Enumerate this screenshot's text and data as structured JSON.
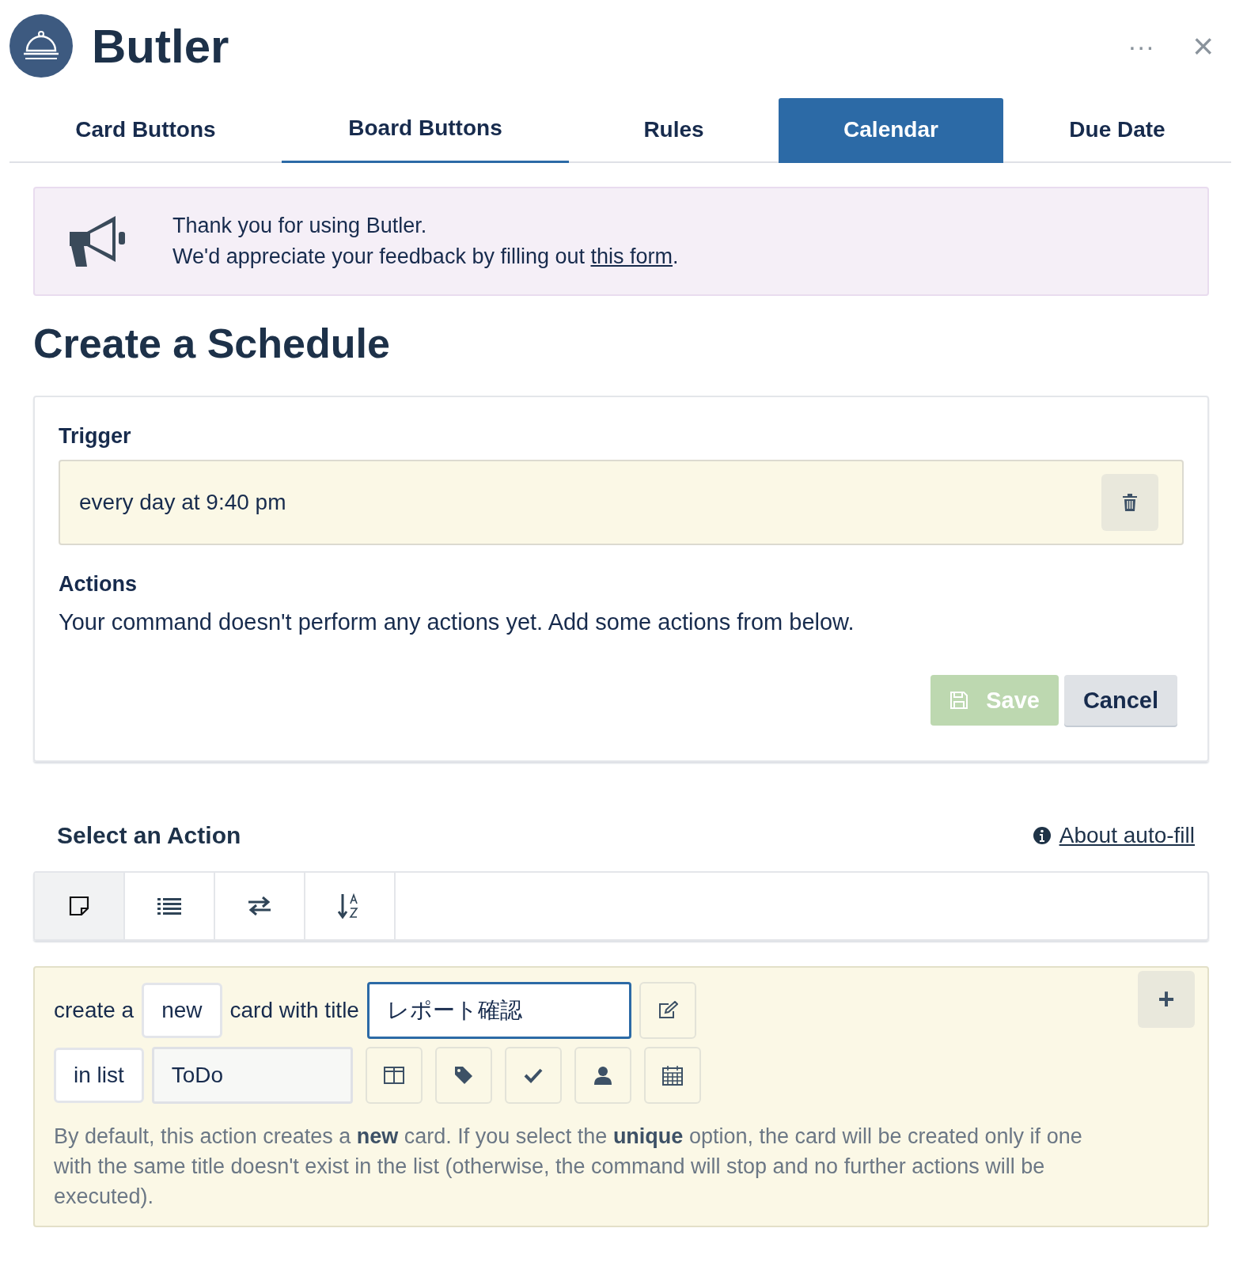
{
  "header": {
    "title": "Butler",
    "more": "···",
    "close": "×"
  },
  "tabs": [
    {
      "label": "Card Buttons",
      "selected": false,
      "hovered": false
    },
    {
      "label": "Board Buttons",
      "selected": false,
      "hovered": true
    },
    {
      "label": "Rules",
      "selected": false,
      "hovered": false
    },
    {
      "label": "Calendar",
      "selected": true,
      "hovered": false
    },
    {
      "label": "Due Date",
      "selected": false,
      "hovered": false
    }
  ],
  "notice": {
    "line1": "Thank you for using Butler.",
    "line2": "We'd appreciate your feedback by filling out",
    "link": "this form",
    "end": "."
  },
  "heading": "Create a Schedule",
  "schedule": {
    "trigger_label": "Trigger",
    "trigger": "every day at 9:40 pm",
    "actions_label": "Actions",
    "actions_text": "Your command doesn't perform any actions yet. Add some actions from below.",
    "save": {
      "label": "Save",
      "disabled": true
    },
    "cancel": {
      "label": "Cancel"
    }
  },
  "select_action": {
    "title": "Select an Action",
    "help_link": "About auto-fill"
  },
  "action_tabs": [
    {
      "kind": "card",
      "selected": true
    },
    {
      "kind": "list",
      "selected": false
    },
    {
      "kind": "move",
      "selected": false
    },
    {
      "kind": "sort",
      "selected": false
    }
  ],
  "action": {
    "prefix": "create a",
    "mode": "new",
    "middle": "card with title",
    "title_value": "レポート確認",
    "list_prefix": "in list",
    "list_value": "ToDo",
    "tools": [
      {
        "kind": "columns"
      },
      {
        "kind": "tag"
      },
      {
        "kind": "check"
      },
      {
        "kind": "user"
      },
      {
        "kind": "calendar"
      }
    ],
    "add": "+",
    "description": "By default, this action creates a **new** card. If you select the **unique** option, the card will be created only if one with the same title doesn't exist in the list (otherwise, the command will stop and no further actions will be executed)."
  }
}
